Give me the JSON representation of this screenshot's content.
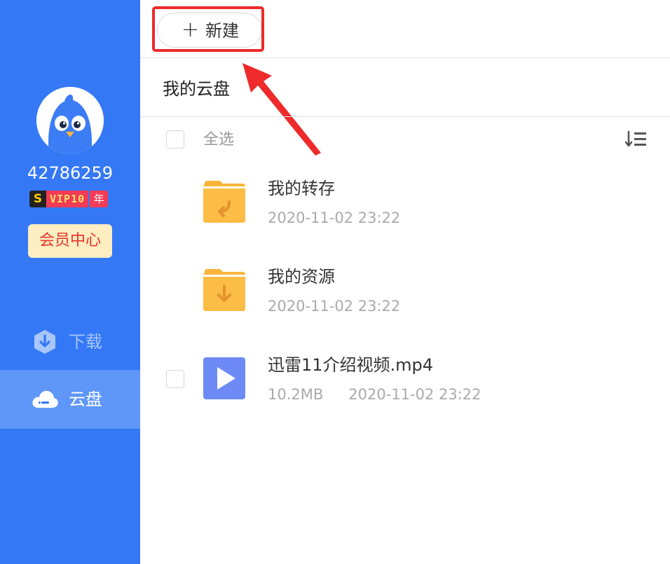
{
  "sidebar": {
    "user_id": "42786259",
    "vip": {
      "s_badge": "S",
      "level_label": "VIP10",
      "year_label": "年"
    },
    "member_center_label": "会员中心",
    "nav": [
      {
        "label": "下载",
        "icon": "download-shield-icon",
        "selected": false
      },
      {
        "label": "云盘",
        "icon": "cloud-drive-icon",
        "selected": true
      }
    ],
    "colors": {
      "background": "#3478f6",
      "selected": "#5f97f8"
    }
  },
  "toolbar": {
    "new_plus": "+",
    "new_label": "新建"
  },
  "breadcrumb": "我的云盘",
  "list_header": {
    "select_all_label": "全选",
    "sort_icon": "sort-descending-icon"
  },
  "files": [
    {
      "name": "我的转存",
      "meta_size": "",
      "date": "2020-11-02 23:22",
      "type": "folder",
      "icon": "folder-transfer-icon"
    },
    {
      "name": "我的资源",
      "meta_size": "",
      "date": "2020-11-02 23:22",
      "type": "folder",
      "icon": "folder-download-icon"
    },
    {
      "name": "迅雷11介绍视频.mp4",
      "meta_size": "10.2MB",
      "date": "2020-11-02 23:22",
      "type": "video",
      "icon": "video-play-icon"
    }
  ],
  "annotations": {
    "highlight_color": "#ee2a2a"
  }
}
